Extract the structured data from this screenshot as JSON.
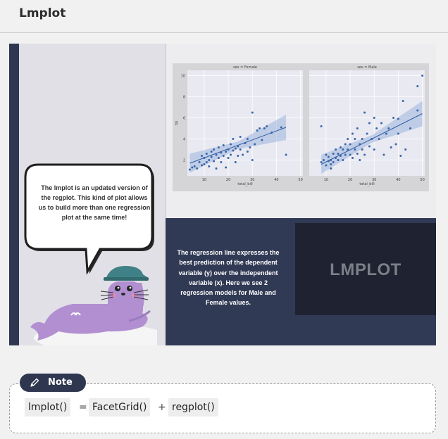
{
  "header": {
    "title": "Lmplot"
  },
  "slide": {
    "bubble_text": "The lmplot is an updated version of the regplot. This kind of plot allows us to build more than one regression plot at the same time!",
    "description": "The regression line expresses the best prediction of the dependent variable (y) over the independent variable (x). Here we see 2 regression models for Male and Female values.",
    "panel_label": "LMPLOT"
  },
  "note": {
    "tag_label": "Note",
    "tag_icon": "pencil-icon",
    "code_parts": [
      "lmplot()",
      "=",
      "FacetGrid()",
      "+",
      "regplot()"
    ]
  },
  "chart_data": [
    {
      "type": "scatter",
      "title": "sex = Female",
      "xlabel": "total_bill",
      "ylabel": "tip",
      "xlim": [
        3,
        51
      ],
      "ylim": [
        0.5,
        10.5
      ],
      "xticks": [
        10,
        20,
        30,
        40,
        50
      ],
      "yticks": [
        2,
        4,
        6,
        8,
        10
      ],
      "grid": true,
      "points": [
        [
          4,
          1.1
        ],
        [
          5,
          1.3
        ],
        [
          6,
          1.4
        ],
        [
          7,
          1.2
        ],
        [
          8,
          1.8
        ],
        [
          9,
          1.5
        ],
        [
          9,
          2.4
        ],
        [
          10,
          1.6
        ],
        [
          10,
          2.2
        ],
        [
          11,
          1.8
        ],
        [
          11,
          2.6
        ],
        [
          12,
          2.0
        ],
        [
          12,
          1.4
        ],
        [
          13,
          2.3
        ],
        [
          13,
          2.8
        ],
        [
          14,
          1.9
        ],
        [
          14,
          3.0
        ],
        [
          15,
          2.5
        ],
        [
          15,
          1.2
        ],
        [
          16,
          2.2
        ],
        [
          16,
          3.2
        ],
        [
          17,
          2.7
        ],
        [
          17,
          1.8
        ],
        [
          18,
          3.4
        ],
        [
          18,
          2.4
        ],
        [
          19,
          2.8
        ],
        [
          19,
          1.3
        ],
        [
          20,
          3.0
        ],
        [
          20,
          2.2
        ],
        [
          21,
          3.5
        ],
        [
          21,
          2.5
        ],
        [
          22,
          2.9
        ],
        [
          22,
          4.0
        ],
        [
          23,
          3.1
        ],
        [
          23,
          1.8
        ],
        [
          24,
          3.3
        ],
        [
          24,
          2.4
        ],
        [
          25,
          3.0
        ],
        [
          25,
          4.2
        ],
        [
          26,
          2.5
        ],
        [
          27,
          3.6
        ],
        [
          28,
          2.8
        ],
        [
          28,
          4.0
        ],
        [
          29,
          3.2
        ],
        [
          30,
          2.0
        ],
        [
          31,
          3.5
        ],
        [
          32,
          4.8
        ],
        [
          33,
          5.0
        ],
        [
          34,
          3.9
        ],
        [
          35,
          5.0
        ],
        [
          36,
          5.2
        ],
        [
          30,
          6.5
        ],
        [
          38,
          4.6
        ],
        [
          42,
          5.1
        ],
        [
          44,
          2.5
        ]
      ],
      "regression_line": [
        [
          4,
          1.7
        ],
        [
          44,
          5.1
        ]
      ]
    },
    {
      "type": "scatter",
      "title": "sex = Male",
      "xlabel": "total_bill",
      "ylabel": "",
      "xlim": [
        3,
        51
      ],
      "ylim": [
        0.5,
        10.5
      ],
      "xticks": [
        10,
        20,
        30,
        40,
        50
      ],
      "yticks": [
        2,
        4,
        6,
        8,
        10
      ],
      "grid": true,
      "points": [
        [
          8,
          1.8
        ],
        [
          9,
          2.0
        ],
        [
          10,
          1.5
        ],
        [
          10,
          2.5
        ],
        [
          11,
          1.9
        ],
        [
          11,
          2.3
        ],
        [
          12,
          2.0
        ],
        [
          12,
          1.6
        ],
        [
          13,
          2.6
        ],
        [
          13,
          1.8
        ],
        [
          14,
          2.2
        ],
        [
          14,
          3.0
        ],
        [
          15,
          2.0
        ],
        [
          15,
          2.6
        ],
        [
          16,
          2.4
        ],
        [
          16,
          3.2
        ],
        [
          17,
          2.0
        ],
        [
          17,
          3.0
        ],
        [
          18,
          3.5
        ],
        [
          18,
          2.5
        ],
        [
          19,
          3.0
        ],
        [
          19,
          4.0
        ],
        [
          20,
          2.5
        ],
        [
          20,
          3.5
        ],
        [
          21,
          2.2
        ],
        [
          21,
          4.5
        ],
        [
          22,
          3.0
        ],
        [
          22,
          4.0
        ],
        [
          23,
          2.6
        ],
        [
          23,
          5.0
        ],
        [
          24,
          3.5
        ],
        [
          25,
          4.0
        ],
        [
          25,
          3.0
        ],
        [
          26,
          6.5
        ],
        [
          26,
          2.5
        ],
        [
          27,
          4.5
        ],
        [
          28,
          5.5
        ],
        [
          28,
          3.3
        ],
        [
          29,
          4.0
        ],
        [
          30,
          3.0
        ],
        [
          30,
          6.0
        ],
        [
          31,
          5.0
        ],
        [
          32,
          4.0
        ],
        [
          33,
          5.5
        ],
        [
          34,
          2.5
        ],
        [
          35,
          4.5
        ],
        [
          36,
          5.0
        ],
        [
          37,
          3.2
        ],
        [
          38,
          6.0
        ],
        [
          39,
          3.5
        ],
        [
          40,
          4.5
        ],
        [
          40,
          5.9
        ],
        [
          42,
          7.6
        ],
        [
          43,
          3.0
        ],
        [
          45,
          5.0
        ],
        [
          48,
          9.0
        ],
        [
          48,
          6.7
        ],
        [
          50,
          10.0
        ],
        [
          8,
          5.2
        ],
        [
          12,
          1.2
        ],
        [
          24,
          2.0
        ],
        [
          41,
          2.4
        ]
      ],
      "regression_line": [
        [
          8,
          1.6
        ],
        [
          50,
          6.4
        ]
      ]
    }
  ]
}
